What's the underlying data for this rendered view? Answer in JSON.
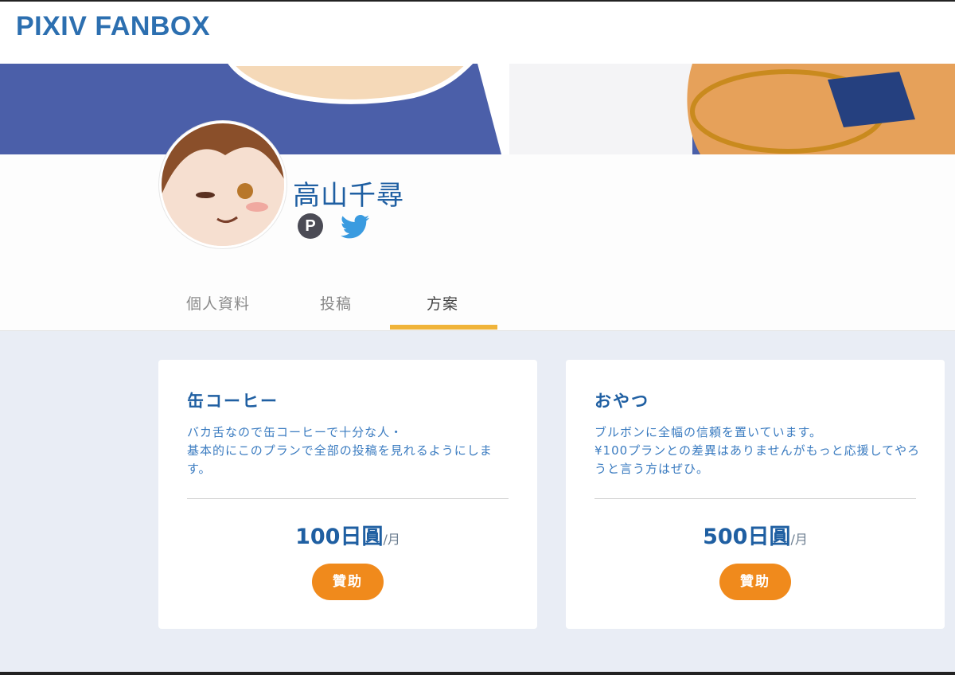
{
  "brand": {
    "logo_text": "PIXIV FANBOX",
    "accent": "#2c6fb0"
  },
  "creator": {
    "name": "高山千尋",
    "social": [
      {
        "name": "pixiv-icon",
        "glyph": "P"
      },
      {
        "name": "twitter-icon"
      }
    ]
  },
  "tabs": [
    {
      "label": "個人資料",
      "active": false
    },
    {
      "label": "投稿",
      "active": false
    },
    {
      "label": "方案",
      "active": true
    }
  ],
  "plans": [
    {
      "title": "缶コーヒー",
      "description": "バカ舌なので缶コーヒーで十分な人・\n基本的にこのプランで全部の投稿を見れるようにします。",
      "price": "100日圓",
      "period": "/月",
      "button_label": "贊助"
    },
    {
      "title": "おやつ",
      "description": "ブルボンに全幅の信頼を置いています。\n¥100プランとの差異はありませんがもっと応援してやろうと言う方はぜひ。",
      "price": "500日圓",
      "period": "/月",
      "button_label": "贊助"
    }
  ],
  "colors": {
    "tab_active_underline": "#f0b43a",
    "support_button": "#f08a1c",
    "page_bg": "#e9edf5"
  }
}
